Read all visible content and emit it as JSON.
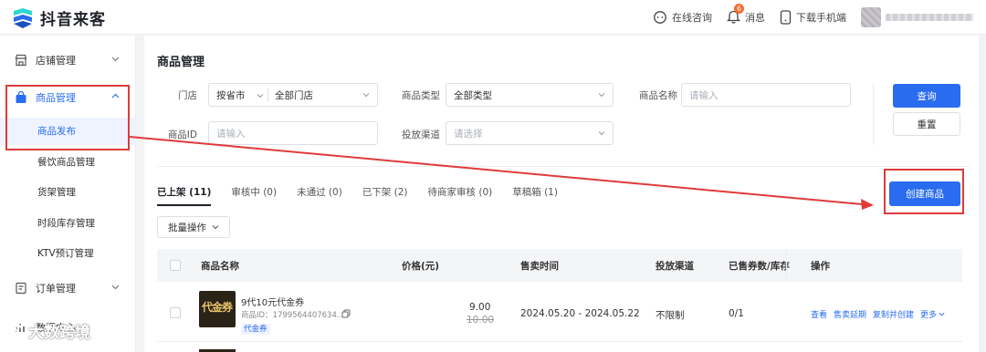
{
  "app": {
    "name": "抖音来客"
  },
  "topbar": {
    "consult_label": "在线咨询",
    "message_label": "消息",
    "message_count": "6",
    "download_label": "下载手机端"
  },
  "sidebar": {
    "groups": [
      {
        "label": "店铺管理"
      },
      {
        "label": "商品管理"
      },
      {
        "label": "订单管理"
      },
      {
        "label": "数据中心"
      }
    ],
    "sub_items": [
      {
        "label": "商品发布"
      },
      {
        "label": "餐饮商品管理"
      },
      {
        "label": "货架管理"
      },
      {
        "label": "时段库存管理"
      },
      {
        "label": "KTV预订管理"
      }
    ]
  },
  "page": {
    "title": "商品管理"
  },
  "filters": {
    "store_label": "门店",
    "store_scope": "按省市",
    "store_value": "全部门店",
    "type_label": "商品类型",
    "type_value": "全部类型",
    "name_label": "商品名称",
    "name_placeholder": "请输入",
    "id_label": "商品ID",
    "id_placeholder": "请输入",
    "channel_label": "投放渠道",
    "channel_placeholder": "请选择"
  },
  "buttons": {
    "query": "查询",
    "reset": "重置",
    "create": "创建商品",
    "batch": "批量操作"
  },
  "tabs": [
    {
      "label": "已上架 (11)",
      "active": true
    },
    {
      "label": "审核中 (0)"
    },
    {
      "label": "未通过 (0)"
    },
    {
      "label": "已下架 (2)"
    },
    {
      "label": "待商家审核 (0)"
    },
    {
      "label": "草稿箱 (1)"
    }
  ],
  "table": {
    "columns": [
      "商品名称",
      "价格(元)",
      "售卖时间",
      "投放渠道",
      "已售券数/库存",
      "操作"
    ],
    "rows": [
      {
        "name": "9代10元代金券",
        "thumb_text": "代金券",
        "id_text": "商品ID：17995644076​34...",
        "tag": "代金券",
        "price": "9.00",
        "original_price": "10.00",
        "sale_time": "2024.05.20 - 2024.05.22",
        "channel": "不限制",
        "sold": "0/1",
        "ops": [
          "查看",
          "售卖延期",
          "复制并创建",
          "更多"
        ]
      }
    ]
  },
  "watermark": {
    "text": "大数跨境"
  },
  "colors": {
    "primary": "#2a6cf0",
    "annotation": "#e03a3a",
    "badge": "#f56c2d"
  }
}
